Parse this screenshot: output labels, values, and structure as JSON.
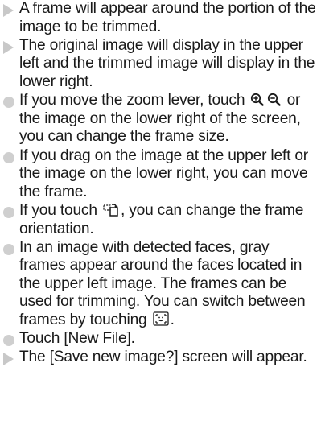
{
  "instructions": [
    {
      "marker": "triangle",
      "segments": [
        {
          "text": "A frame will appear around the portion of the image to be trimmed."
        }
      ]
    },
    {
      "marker": "triangle",
      "segments": [
        {
          "text": "The original image will display in the upper left and the trimmed image will display in the lower right."
        }
      ]
    },
    {
      "marker": "circle",
      "segments": [
        {
          "text": "If you move the zoom lever, touch "
        },
        {
          "icon": "zoom-in-icon"
        },
        {
          "icon": "zoom-out-icon"
        },
        {
          "text": " or the image on the lower right of the screen, you can change the frame size."
        }
      ]
    },
    {
      "marker": "circle",
      "segments": [
        {
          "text": "If you drag on the image at the upper left or the image on the lower right, you can move the frame."
        }
      ]
    },
    {
      "marker": "circle",
      "segments": [
        {
          "text": "If you touch "
        },
        {
          "icon": "rotate-frame-icon"
        },
        {
          "text": ", you can change the frame orientation."
        }
      ]
    },
    {
      "marker": "circle",
      "segments": [
        {
          "text": "In an image with detected faces, gray frames appear around the faces located in the upper left image. The frames can be used for trimming. You can switch between frames by touching "
        },
        {
          "icon": "face-select-icon"
        },
        {
          "text": "."
        }
      ]
    },
    {
      "marker": "circle",
      "segments": [
        {
          "text": "Touch [New File]."
        }
      ]
    },
    {
      "marker": "triangle",
      "segments": [
        {
          "text": "The [Save new image?] screen will appear."
        }
      ]
    }
  ]
}
